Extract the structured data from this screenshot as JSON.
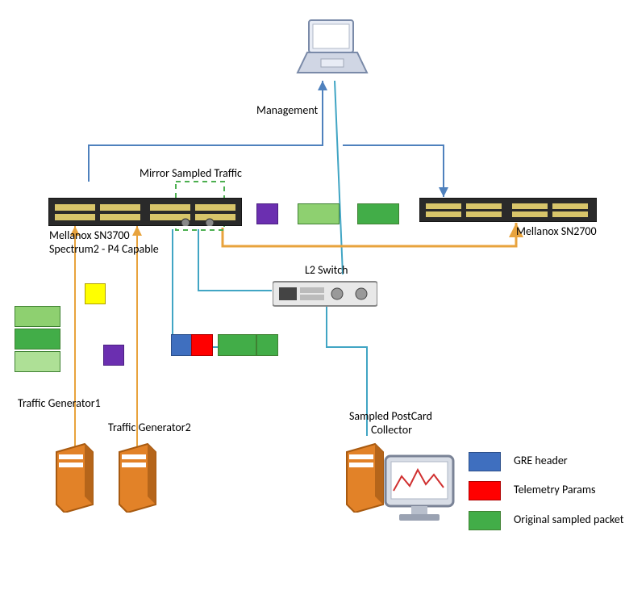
{
  "labels": {
    "management": "Management",
    "mirror": "Mirror Sampled Traffic",
    "sn3700_line1": "Mellanox SN3700",
    "sn3700_line2": "Spectrum2 - P4 Capable",
    "sn2700": "Mellanox SN2700",
    "l2switch": "L2 Switch",
    "gen1": "Traffic Generator1",
    "gen2": "Traffic Generator2",
    "collector_line1": "Sampled PostCard",
    "collector_line2": "Collector",
    "legend_gre": "GRE header",
    "legend_tel": "Telemetry Params",
    "legend_pkt": "Original sampled packet"
  },
  "colors": {
    "mgmt_arrow": "#4f81bd",
    "switch_link": "#41a5c4",
    "generator_link": "#e8a33d",
    "dashed_box": "#4caf50"
  }
}
